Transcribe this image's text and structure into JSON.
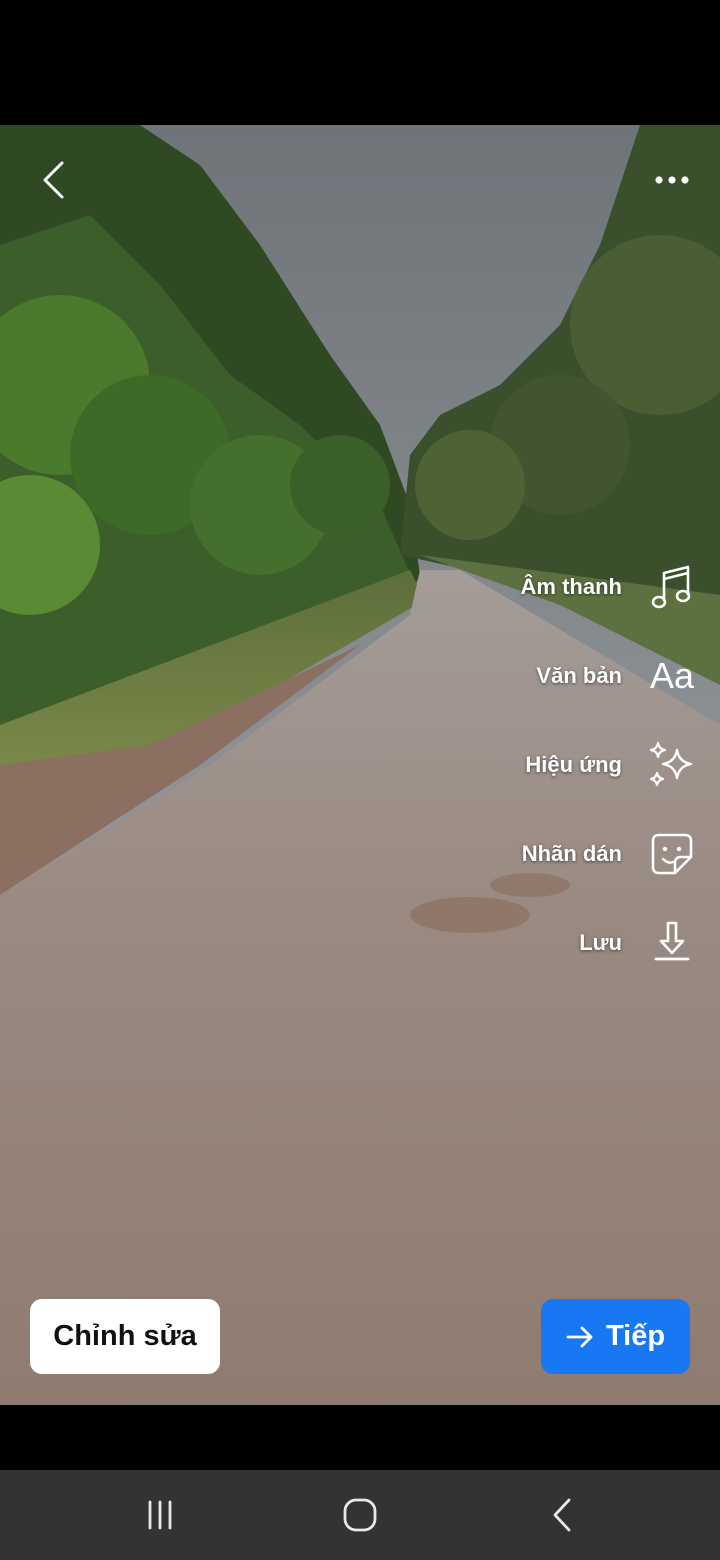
{
  "tools": [
    {
      "label": "Âm thanh",
      "icon": "music-note-icon"
    },
    {
      "label": "Văn bản",
      "icon": "text-aa-icon",
      "glyph": "Aa"
    },
    {
      "label": "Hiệu ứng",
      "icon": "sparkles-icon"
    },
    {
      "label": "Nhãn dán",
      "icon": "sticker-icon"
    },
    {
      "label": "Lưu",
      "icon": "download-icon"
    }
  ],
  "edit_button": {
    "label": "Chỉnh sửa"
  },
  "next_button": {
    "label": "Tiếp",
    "color": "#1877f2"
  },
  "icons": {
    "back": "chevron-left-icon",
    "more": "more-dots-icon"
  },
  "navbar": {
    "recents": "recents-icon",
    "home": "home-icon",
    "back": "nav-back-icon",
    "color": "#333333"
  }
}
